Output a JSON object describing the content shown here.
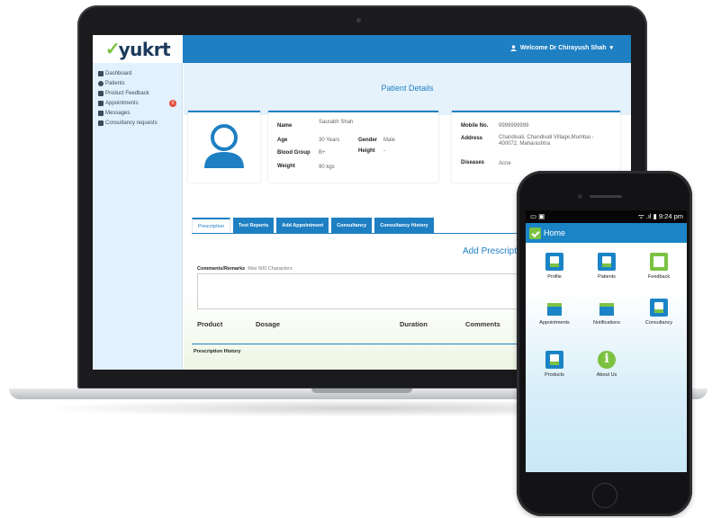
{
  "laptop": {
    "header": {
      "logo": "yukrt",
      "welcome": "Welcome Dr Chirayush Shah"
    },
    "sidebar": {
      "items": [
        {
          "label": "Dashboard",
          "icon": "dashboard-icon"
        },
        {
          "label": "Patients",
          "icon": "user-icon"
        },
        {
          "label": "Product Feedback",
          "icon": "feedback-icon"
        },
        {
          "label": "Appointments",
          "icon": "calendar-icon",
          "badge": "0"
        },
        {
          "label": "Messages",
          "icon": "messages-icon"
        },
        {
          "label": "Consultancy requests",
          "icon": "handshake-icon"
        }
      ]
    },
    "page_title": "Patient Details",
    "patient": {
      "name_label": "Name",
      "name_value": "Saurabh Shah",
      "age_label": "Age",
      "age_value": "30 Years",
      "gender_label": "Gender",
      "gender_value": "Male",
      "blood_label": "Blood Group",
      "blood_value": "B+",
      "height_label": "Height",
      "height_value": "-",
      "weight_label": "Weight",
      "weight_value": "90 kgs"
    },
    "contact": {
      "mobile_label": "Mobile No.",
      "mobile_value": "9999999999",
      "address_label": "Address",
      "address_value": "Chandivali, Chandivali Village,Mumbai - 400072, Maharashtra",
      "diseases_label": "Diseases",
      "diseases_value": "Acne"
    },
    "tabs": [
      "Prescription",
      "Test Reports",
      "Add Appointment",
      "Consultancy",
      "Consultancy History"
    ],
    "add_prescription_title": "Add Prescription",
    "comments_label": "Comments/Remarks",
    "comments_hint": "Max 500 Characters",
    "table_headers": [
      "Product",
      "Dosage",
      "Duration",
      "Comments"
    ],
    "history_label": "Prescription History"
  },
  "phone": {
    "status_right": "9:24 pm",
    "app_title": "Home",
    "grid": [
      {
        "label": "Profile",
        "icon": "profile-icon"
      },
      {
        "label": "Patients",
        "icon": "patients-icon"
      },
      {
        "label": "Feedback",
        "icon": "feedback-edit-icon"
      },
      {
        "label": "Appointments",
        "icon": "appointments-envelope-icon"
      },
      {
        "label": "Notifications",
        "icon": "notifications-envelope-icon"
      },
      {
        "label": "Consultancy",
        "icon": "consultancy-icon"
      },
      {
        "label": "Products",
        "icon": "products-icon"
      },
      {
        "label": "About Us",
        "icon": "info-icon"
      }
    ]
  },
  "colors": {
    "primary": "#1e7fc2",
    "accent": "#7cc242",
    "sidebar": "#e2f1fb"
  }
}
